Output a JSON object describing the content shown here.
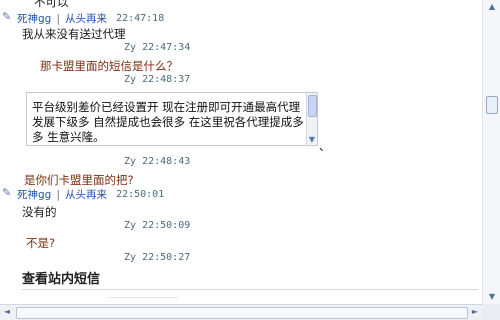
{
  "messages": [
    {
      "text": "不可以"
    },
    {
      "sender": "死神gg",
      "separator": "|",
      "sender_link": "从头再来",
      "time": "22:47:18",
      "text": "我从来没有送过代理"
    },
    {
      "sender": "Zy",
      "time": "22:47:34",
      "text": "那卡盟里面的短信是什么？"
    },
    {
      "sender": "Zy",
      "time": "22:48:37",
      "card_text": "平台级别差价已经设置开 现在注册即可开通最高代理 发展下级多 自然提成也会很多 在这里祝各代理提成多多 生意兴隆。",
      "trailing_mark": "、"
    },
    {
      "sender": "Zy",
      "time": "22:48:43",
      "text": "是你们卡盟里面的把?"
    },
    {
      "sender": "死神gg",
      "separator": "|",
      "sender_link": "从头再来",
      "time": "22:50:01",
      "text": "没有的"
    },
    {
      "sender": "Zy",
      "time": "22:50:09",
      "text": "不是?"
    },
    {
      "sender": "Zy",
      "time": "22:50:27"
    }
  ],
  "section": {
    "title": "查看站内短信"
  },
  "scroll": {
    "up_arrow": "▲",
    "down_arrow": "▼",
    "left_arrow": "◄",
    "right_arrow": "►"
  },
  "colors": {
    "brown_text": "#7a2e12",
    "sender_blue": "#2255aa",
    "time_gray": "#4a6b7a"
  }
}
